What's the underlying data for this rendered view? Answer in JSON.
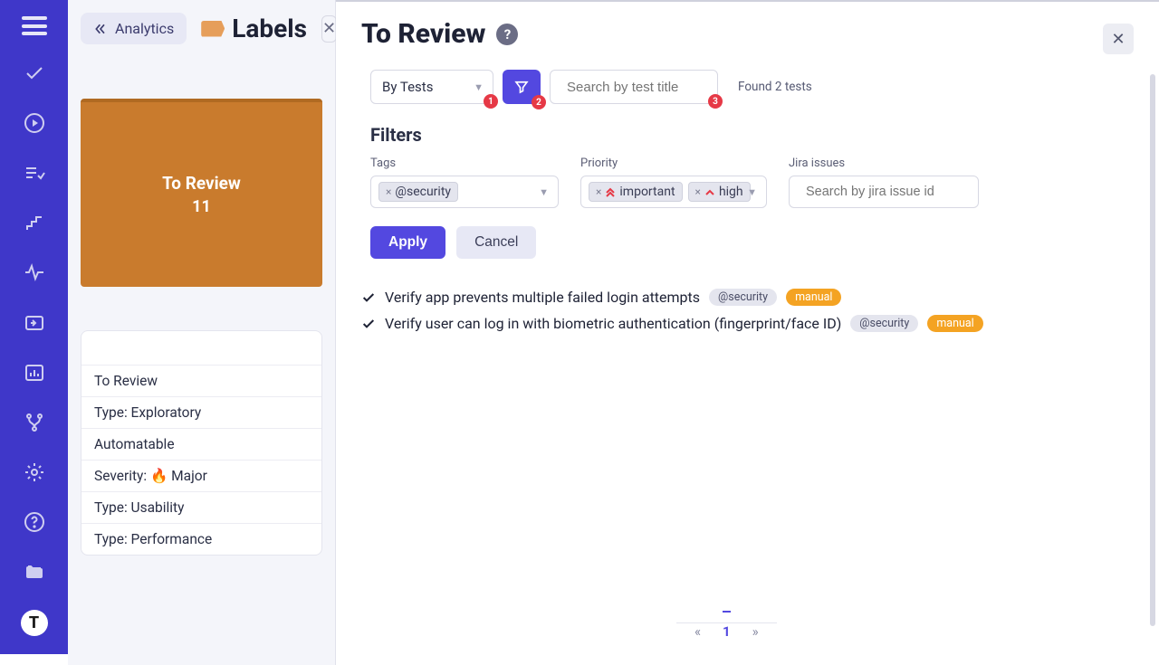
{
  "crumbs": {
    "analytics": "Analytics",
    "labels": "Labels"
  },
  "card": {
    "title": "To Review",
    "count": "11"
  },
  "label_list": [
    "To Review",
    "Type: Exploratory",
    "Automatable",
    "Severity: 🔥 Major",
    "Type: Usability",
    "Type: Performance"
  ],
  "main": {
    "title": "To Review"
  },
  "toolbar": {
    "by_tests": "By Tests",
    "badge1": "1",
    "badge2": "2",
    "badge3": "3",
    "search_placeholder": "Search by test title",
    "found_text": "Found 2 tests"
  },
  "filters_title": "Filters",
  "filters": {
    "tags_label": "Tags",
    "priority_label": "Priority",
    "jira_label": "Jira issues",
    "tag_chip": "@security",
    "pri_important": "important",
    "pri_high": "high",
    "jira_placeholder": "Search by jira issue id",
    "apply": "Apply",
    "cancel": "Cancel"
  },
  "tests": [
    {
      "title": "Verify app prevents multiple failed login attempts",
      "tag": "@security",
      "manual": "manual"
    },
    {
      "title": "Verify user can log in with biometric authentication (fingerprint/face ID)",
      "tag": "@security",
      "manual": "manual"
    }
  ],
  "pagination": {
    "prev": "«",
    "page": "1",
    "next": "»"
  }
}
